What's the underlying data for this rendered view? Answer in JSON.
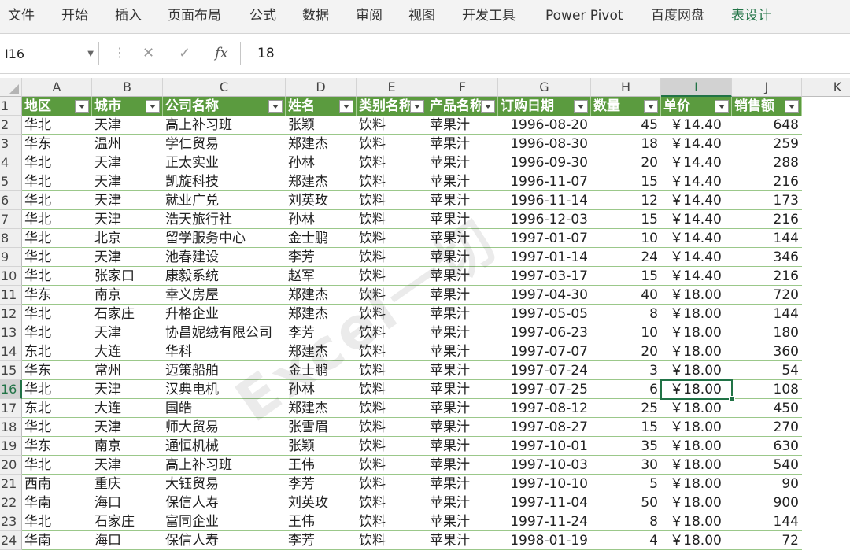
{
  "ribbon": {
    "tabs": [
      "文件",
      "开始",
      "插入",
      "页面布局",
      "公式",
      "数据",
      "审阅",
      "视图",
      "开发工具",
      "Power Pivot",
      "百度网盘",
      "表设计"
    ],
    "active": "表设计"
  },
  "formula_bar": {
    "name_box": "I16",
    "cancel_glyph": "✕",
    "enter_glyph": "✓",
    "fx_glyph": "fx",
    "value": "18"
  },
  "columns": [
    "A",
    "B",
    "C",
    "D",
    "E",
    "F",
    "G",
    "H",
    "I",
    "J",
    "K"
  ],
  "selected_column": "I",
  "selected_row": "16",
  "watermark": "Excel一切",
  "table": {
    "headers": [
      "地区",
      "城市",
      "公司名称",
      "姓名",
      "类别名称",
      "产品名称",
      "订购日期",
      "数量",
      "单价",
      "销售额"
    ],
    "rows": [
      [
        "华北",
        "天津",
        "高上补习班",
        "张颖",
        "饮料",
        "苹果汁",
        "1996-08-20",
        "45",
        "￥14.40",
        "648"
      ],
      [
        "华东",
        "温州",
        "学仁贸易",
        "郑建杰",
        "饮料",
        "苹果汁",
        "1996-08-30",
        "18",
        "￥14.40",
        "259"
      ],
      [
        "华北",
        "天津",
        "正太实业",
        "孙林",
        "饮料",
        "苹果汁",
        "1996-09-30",
        "20",
        "￥14.40",
        "288"
      ],
      [
        "华北",
        "天津",
        "凯旋科技",
        "郑建杰",
        "饮料",
        "苹果汁",
        "1996-11-07",
        "15",
        "￥14.40",
        "216"
      ],
      [
        "华北",
        "天津",
        "就业广兑",
        "刘英玫",
        "饮料",
        "苹果汁",
        "1996-11-14",
        "12",
        "￥14.40",
        "173"
      ],
      [
        "华北",
        "天津",
        "浩天旅行社",
        "孙林",
        "饮料",
        "苹果汁",
        "1996-12-03",
        "15",
        "￥14.40",
        "216"
      ],
      [
        "华北",
        "北京",
        "留学服务中心",
        "金士鹏",
        "饮料",
        "苹果汁",
        "1997-01-07",
        "10",
        "￥14.40",
        "144"
      ],
      [
        "华北",
        "天津",
        "池春建设",
        "李芳",
        "饮料",
        "苹果汁",
        "1997-01-14",
        "24",
        "￥14.40",
        "346"
      ],
      [
        "华北",
        "张家口",
        "康毅系统",
        "赵军",
        "饮料",
        "苹果汁",
        "1997-03-17",
        "15",
        "￥14.40",
        "216"
      ],
      [
        "华东",
        "南京",
        "幸义房屋",
        "郑建杰",
        "饮料",
        "苹果汁",
        "1997-04-30",
        "40",
        "￥18.00",
        "720"
      ],
      [
        "华北",
        "石家庄",
        "升格企业",
        "郑建杰",
        "饮料",
        "苹果汁",
        "1997-05-05",
        "8",
        "￥18.00",
        "144"
      ],
      [
        "华北",
        "天津",
        "协昌妮绒有限公司",
        "李芳",
        "饮料",
        "苹果汁",
        "1997-06-23",
        "10",
        "￥18.00",
        "180"
      ],
      [
        "东北",
        "大连",
        "华科",
        "郑建杰",
        "饮料",
        "苹果汁",
        "1997-07-07",
        "20",
        "￥18.00",
        "360"
      ],
      [
        "华东",
        "常州",
        "迈策船舶",
        "金士鹏",
        "饮料",
        "苹果汁",
        "1997-07-24",
        "3",
        "￥18.00",
        "54"
      ],
      [
        "华北",
        "天津",
        "汉典电机",
        "孙林",
        "饮料",
        "苹果汁",
        "1997-07-25",
        "6",
        "￥18.00",
        "108"
      ],
      [
        "东北",
        "大连",
        "国皓",
        "郑建杰",
        "饮料",
        "苹果汁",
        "1997-08-12",
        "25",
        "￥18.00",
        "450"
      ],
      [
        "华北",
        "天津",
        "师大贸易",
        "张雪眉",
        "饮料",
        "苹果汁",
        "1997-08-27",
        "15",
        "￥18.00",
        "270"
      ],
      [
        "华东",
        "南京",
        "通恒机械",
        "张颖",
        "饮料",
        "苹果汁",
        "1997-10-01",
        "35",
        "￥18.00",
        "630"
      ],
      [
        "华北",
        "天津",
        "高上补习班",
        "王伟",
        "饮料",
        "苹果汁",
        "1997-10-03",
        "30",
        "￥18.00",
        "540"
      ],
      [
        "西南",
        "重庆",
        "大钰贸易",
        "李芳",
        "饮料",
        "苹果汁",
        "1997-10-10",
        "5",
        "￥18.00",
        "90"
      ],
      [
        "华南",
        "海口",
        "保信人寿",
        "刘英玫",
        "饮料",
        "苹果汁",
        "1997-11-04",
        "50",
        "￥18.00",
        "900"
      ],
      [
        "华北",
        "石家庄",
        "富同企业",
        "王伟",
        "饮料",
        "苹果汁",
        "1997-11-24",
        "8",
        "￥18.00",
        "144"
      ],
      [
        "华南",
        "海口",
        "保信人寿",
        "李芳",
        "饮料",
        "苹果汁",
        "1998-01-19",
        "4",
        "￥18.00",
        "72"
      ]
    ]
  }
}
